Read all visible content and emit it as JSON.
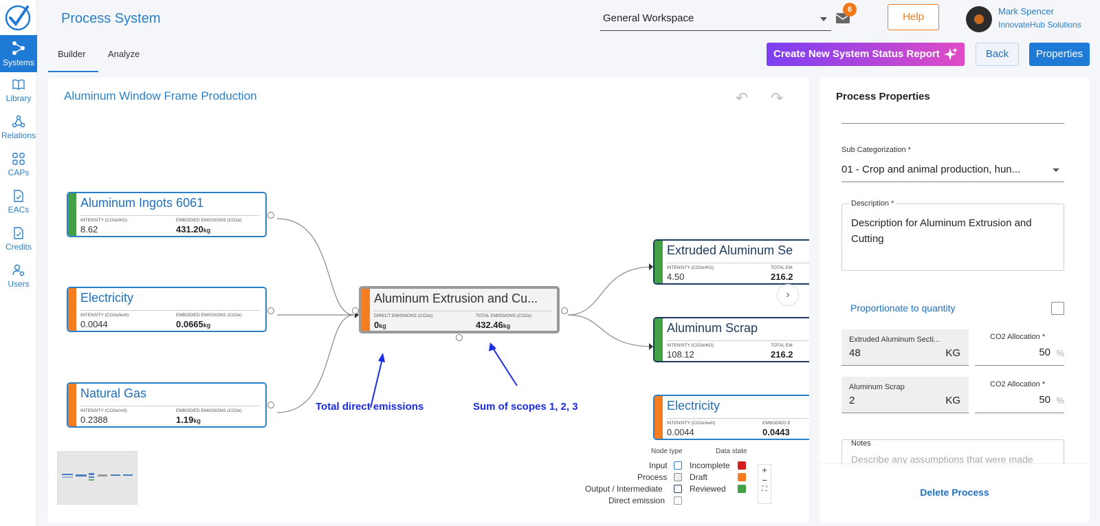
{
  "app": {
    "title": "Process System"
  },
  "workspace": {
    "selected": "General Workspace"
  },
  "notifications": {
    "count": "6"
  },
  "header": {
    "help_label": "Help",
    "user_name": "Mark Spencer",
    "user_org": "InnovateHub Solutions"
  },
  "sidebar": {
    "items": [
      {
        "label": "Systems",
        "icon": "systems-icon"
      },
      {
        "label": "Library",
        "icon": "book-icon"
      },
      {
        "label": "Relations",
        "icon": "relations-icon"
      },
      {
        "label": "CAPs",
        "icon": "grid-icon"
      },
      {
        "label": "EACs",
        "icon": "document-check-icon"
      },
      {
        "label": "Credits",
        "icon": "document-check-icon"
      },
      {
        "label": "Users",
        "icon": "users-gear-icon"
      }
    ]
  },
  "tabs": [
    {
      "label": "Builder",
      "active": true
    },
    {
      "label": "Analyze",
      "active": false
    }
  ],
  "toolbar": {
    "report_label": "Create New System Status Report",
    "back_label": "Back",
    "properties_label": "Properties"
  },
  "canvas": {
    "title": "Aluminum Window Frame Production",
    "nodes": {
      "ingots": {
        "title": "Aluminum Ingots 6061",
        "label1": "INTENSITY (CO2e/KG)",
        "value1": "8.62",
        "label2": "EMBODIED EMISSIONS (CO2e)",
        "value2": "431.20",
        "unit2": "kg",
        "state_color": "#43a047"
      },
      "electricity_in": {
        "title": "Electricity",
        "label1": "INTENSITY (CO2e/kwh)",
        "value1": "0.0044",
        "label2": "EMBODIED EMISSIONS (CO2e)",
        "value2": "0.0665",
        "unit2": "kg",
        "state_color": "#f57c1f"
      },
      "gas": {
        "title": "Natural Gas",
        "label1": "INTENSITY (CO2e/m3)",
        "value1": "0.2388",
        "label2": "EMBODIED EMISSIONS (CO2e)",
        "value2": "1.19",
        "unit2": "kg",
        "state_color": "#f57c1f"
      },
      "process": {
        "title": "Aluminum Extrusion and Cu...",
        "label1": "DIRECT EMISSIONS (CO2e)",
        "value1": "0",
        "unit1": "kg",
        "label2": "TOTAL EMISSIONS (CO2e)",
        "value2": "432.46",
        "unit2": "kg",
        "state_color": "#f57c1f"
      },
      "extruded": {
        "title": "Extruded Aluminum Se",
        "label1": "INTENSITY (CO2e/KG)",
        "value1": "4.50",
        "label2": "TOTAL EM",
        "value2": "216.2",
        "state_color": "#43a047"
      },
      "scrap": {
        "title": "Aluminum Scrap",
        "label1": "INTENSITY (CO2e/KG)",
        "value1": "108.12",
        "label2": "TOTAL EM",
        "value2": "216.2",
        "state_color": "#43a047"
      },
      "electricity_out": {
        "title": "Electricity",
        "label1": "INTENSITY (CO2e/kwh)",
        "value1": "0.0044",
        "label2": "EMBODIED E",
        "value2": "0.0443",
        "state_color": "#f57c1f"
      }
    },
    "annotations": {
      "direct": "Total direct emissions",
      "sum": "Sum of scopes 1, 2, 3"
    },
    "legend": {
      "node_type_header": "Node type",
      "data_state_header": "Data state",
      "node_types": [
        "Input",
        "Process",
        "Output / Intermediate",
        "Direct emission"
      ],
      "states": [
        {
          "label": "Incomplete",
          "color": "#d21f1f"
        },
        {
          "label": "Draft",
          "color": "#f57c1f"
        },
        {
          "label": "Reviewed",
          "color": "#43a047"
        }
      ]
    }
  },
  "panel": {
    "title": "Process Properties",
    "sub_cat_label": "Sub Categorization *",
    "sub_cat_value": "01 - Crop and animal production, hun...",
    "desc_label": "Description *",
    "desc_value": "Description for Aluminum Extrusion and Cutting",
    "proportionate_label": "Proportionate to quantity",
    "outputs": [
      {
        "name": "Extruded Aluminum Secti...",
        "qty": "48",
        "unit": "KG",
        "alloc_label": "CO2 Allocation *",
        "alloc": "50"
      },
      {
        "name": "Aluminum Scrap",
        "qty": "2",
        "unit": "KG",
        "alloc_label": "CO2 Allocation *",
        "alloc": "50"
      }
    ],
    "percent_sign": "%",
    "notes_label": "Notes",
    "notes_placeholder": "Describe any assumptions that were made",
    "delete_label": "Delete Process"
  }
}
